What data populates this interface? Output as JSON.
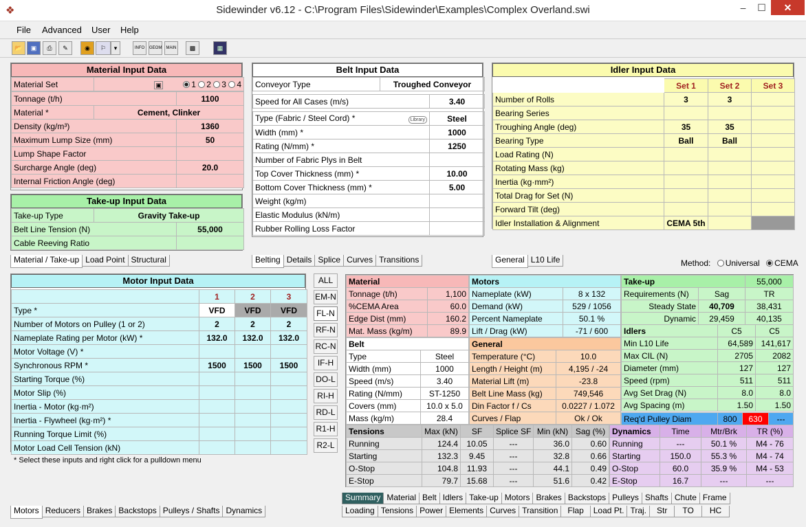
{
  "window": {
    "title": "Sidewinder v6.12 - C:\\Program Files\\Sidewinder\\Examples\\Complex Overland.swi",
    "min": "–",
    "max": "☐",
    "close": "✕"
  },
  "menu": [
    "File",
    "Advanced",
    "User",
    "Help"
  ],
  "toolbar": {
    "info": "INFO",
    "geom": "GEOM",
    "main": "MAIN"
  },
  "material": {
    "title": "Material Input Data",
    "set_label": "Material Set",
    "set_options": [
      "1",
      "2",
      "3",
      "4"
    ],
    "rows": [
      [
        "Tonnage (t/h)",
        "1100"
      ],
      [
        "Material *",
        "Cement, Clinker"
      ],
      [
        "Density (kg/m³)",
        "1360"
      ],
      [
        "Maximum Lump Size (mm)",
        "50"
      ],
      [
        "Lump Shape Factor",
        ""
      ],
      [
        "Surcharge Angle (deg)",
        "20.0"
      ],
      [
        "Internal Friction Angle (deg)",
        ""
      ]
    ]
  },
  "takeup": {
    "title": "Take-up Input Data",
    "rows": [
      [
        "Take-up Type",
        "Gravity Take-up"
      ],
      [
        "Belt Line Tension (N)",
        "55,000"
      ],
      [
        "Cable Reeving Ratio",
        ""
      ]
    ]
  },
  "tabs_left_top": [
    "Material / Take-up",
    "Load Point",
    "Structural"
  ],
  "belt": {
    "title": "Belt Input Data",
    "rows": [
      [
        "Conveyor Type",
        "Troughed Conveyor"
      ],
      [
        "Speed for All Cases (m/s)",
        "3.40"
      ],
      [
        "Type (Fabric / Steel Cord) *",
        "Steel"
      ],
      [
        "Width (mm) *",
        "1000"
      ],
      [
        "Rating (N/mm) *",
        "1250"
      ],
      [
        "Number of Fabric Plys in Belt",
        ""
      ],
      [
        "Top Cover Thickness (mm) *",
        "10.00"
      ],
      [
        "Bottom Cover Thickness (mm) *",
        "5.00"
      ],
      [
        "Weight (kg/m)",
        ""
      ],
      [
        "Elastic Modulus (kN/m)",
        ""
      ],
      [
        "Rubber Rolling Loss Factor",
        ""
      ]
    ],
    "library": "Library"
  },
  "tabs_belt": [
    "Belting",
    "Details",
    "Splice",
    "Curves",
    "Transitions"
  ],
  "idler": {
    "title": "Idler Input Data",
    "sets": [
      "Set 1",
      "Set 2",
      "Set 3"
    ],
    "rows": [
      [
        "Number of Rolls",
        "3",
        "3",
        ""
      ],
      [
        "Bearing Series",
        "",
        "",
        ""
      ],
      [
        "Troughing Angle (deg)",
        "35",
        "35",
        ""
      ],
      [
        "Bearing Type",
        "Ball",
        "Ball",
        ""
      ],
      [
        "Load Rating (N)",
        "",
        "",
        ""
      ],
      [
        "Rotating Mass (kg)",
        "",
        "",
        ""
      ],
      [
        "Inertia (kg·mm²)",
        "",
        "",
        ""
      ],
      [
        "Total Drag for Set (N)",
        "",
        "",
        ""
      ],
      [
        "Forward Tilt (deg)",
        "",
        "",
        ""
      ],
      [
        "Idler Installation & Alignment",
        "CEMA 5th",
        "",
        ""
      ]
    ]
  },
  "tabs_idler": [
    "General",
    "L10 Life"
  ],
  "method": {
    "label": "Method:",
    "options": [
      "Universal",
      "CEMA"
    ]
  },
  "motor": {
    "title": "Motor Input Data",
    "cols": [
      "1",
      "2",
      "3"
    ],
    "rows": [
      [
        "Type *",
        "VFD",
        "VFD",
        "VFD"
      ],
      [
        "Number of Motors on Pulley (1 or 2)",
        "2",
        "2",
        "2"
      ],
      [
        "Nameplate Rating per Motor (kW) *",
        "132.0",
        "132.0",
        "132.0"
      ],
      [
        "Motor Voltage (V) *",
        "",
        "",
        ""
      ],
      [
        "Synchronous RPM *",
        "1500",
        "1500",
        "1500"
      ],
      [
        "Starting Torque (%)",
        "",
        "",
        ""
      ],
      [
        "Motor Slip (%)",
        "",
        "",
        ""
      ],
      [
        "Inertia - Motor (kg·m²)",
        "",
        "",
        ""
      ],
      [
        "Inertia - Flywheel (kg·m²) *",
        "",
        "",
        ""
      ],
      [
        "Running Torque Limit (%)",
        "",
        "",
        ""
      ],
      [
        "Motor Load Cell Tension (kN)",
        "",
        "",
        ""
      ]
    ],
    "note": "* Select these inputs and right click for a pulldown menu"
  },
  "tabs_motor": [
    "Motors",
    "Reducers",
    "Brakes",
    "Backstops",
    "Pulleys / Shafts",
    "Dynamics"
  ],
  "side_buttons": [
    "ALL",
    "EM-N",
    "FL-N",
    "RF-N",
    "RC-N",
    "IF-H",
    "DO-L",
    "RI-H",
    "RD-L",
    "R1-H",
    "R2-L"
  ],
  "summary": {
    "material": {
      "title": "Material",
      "rows": [
        [
          "Tonnage (t/h)",
          "1,100"
        ],
        [
          "%CEMA Area",
          "60.0"
        ],
        [
          "Edge Dist (mm)",
          "160.2"
        ],
        [
          "Mat. Mass (kg/m)",
          "89.9"
        ]
      ]
    },
    "motors": {
      "title": "Motors",
      "rows": [
        [
          "Nameplate (kW)",
          "8 x 132"
        ],
        [
          "Demand (kW)",
          "529 / 1056"
        ],
        [
          "Percent Nameplate",
          "50.1 %"
        ],
        [
          "Lift / Drag (kW)",
          "-71 / 600"
        ]
      ]
    },
    "takeup": {
      "title": "Take-up",
      "value": "55,000",
      "rows": [
        [
          "Requirements (N)",
          "Sag",
          "TR"
        ],
        [
          "Steady State",
          "40,709",
          "38,431"
        ],
        [
          "Dynamic",
          "29,459",
          "40,135"
        ]
      ]
    },
    "belt": {
      "title": "Belt",
      "rows": [
        [
          "Type",
          "Steel"
        ],
        [
          "Width (mm)",
          "1000"
        ],
        [
          "Speed (m/s)",
          "3.40"
        ],
        [
          "Rating (N/mm)",
          "ST-1250"
        ],
        [
          "Covers (mm)",
          "10.0 x 5.0"
        ],
        [
          "Mass (kg/m)",
          "28.4"
        ]
      ]
    },
    "general": {
      "title": "General",
      "rows": [
        [
          "Temperature (°C)",
          "10.0"
        ],
        [
          "Length / Height (m)",
          "4,195 / -24"
        ],
        [
          "Material Lift (m)",
          "-23.8"
        ],
        [
          "Belt Line Mass (kg)",
          "749,546"
        ],
        [
          "Din Factor f / Cs",
          "0.0227 / 1.072"
        ],
        [
          "Curves / Flap",
          "Ok / Ok"
        ]
      ]
    },
    "idlers": {
      "title": "Idlers",
      "cols": [
        "C5",
        "C5"
      ],
      "rows": [
        [
          "Min L10 Life",
          "64,589",
          "141,617"
        ],
        [
          "Max CIL (N)",
          "2705",
          "2082"
        ],
        [
          "Diameter (mm)",
          "127",
          "127"
        ],
        [
          "Speed (rpm)",
          "511",
          "511"
        ],
        [
          "Avg Set Drag (N)",
          "8.0",
          "8.0"
        ],
        [
          "Avg Spacing (m)",
          "1.50",
          "1.50"
        ]
      ],
      "pulley": [
        "Req'd Pulley Diam",
        "800",
        "630",
        "---"
      ]
    },
    "tensions": {
      "title": "Tensions",
      "cols": [
        "Max (kN)",
        "SF",
        "Splice SF",
        "Min (kN)",
        "Sag (%)"
      ],
      "rows": [
        [
          "Running",
          "124.4",
          "10.05",
          "---",
          "36.0",
          "0.60"
        ],
        [
          "Starting",
          "132.3",
          "9.45",
          "---",
          "32.8",
          "0.66"
        ],
        [
          "O-Stop",
          "104.8",
          "11.93",
          "---",
          "44.1",
          "0.49"
        ],
        [
          "E-Stop",
          "79.7",
          "15.68",
          "---",
          "51.6",
          "0.42"
        ]
      ]
    },
    "dynamics": {
      "title": "Dynamics",
      "cols": [
        "Time",
        "Mtr/Brk",
        "TR (%)"
      ],
      "rows": [
        [
          "Running",
          "---",
          "50.1 %",
          "M4 - 76"
        ],
        [
          "Starting",
          "150.0",
          "55.3 %",
          "M4 - 74"
        ],
        [
          "O-Stop",
          "60.0",
          "35.9 %",
          "M4 - 53"
        ],
        [
          "E-Stop",
          "16.7",
          "---",
          "---"
        ]
      ]
    }
  },
  "tabs_summary_1": [
    "Summary",
    "Material",
    "Belt",
    "Idlers",
    "Take-up",
    "Motors",
    "Brakes",
    "Backstops",
    "Pulleys",
    "Shafts",
    "Chute",
    "Frame"
  ],
  "tabs_summary_2": [
    "Loading",
    "Tensions",
    "Power",
    "Elements",
    "Curves",
    "Transition",
    "Flap",
    "Load Pt.",
    "Traj.",
    "Str",
    "TO",
    "HC"
  ],
  "colors": {
    "pink": "#f7b8b8",
    "green": "#a8f0a8",
    "yellow": "#fbfbae",
    "cyan": "#b6f2f5",
    "red": "#ff0000",
    "blue": "#4ea8f0",
    "summary_tab": "#2f5f5f"
  }
}
